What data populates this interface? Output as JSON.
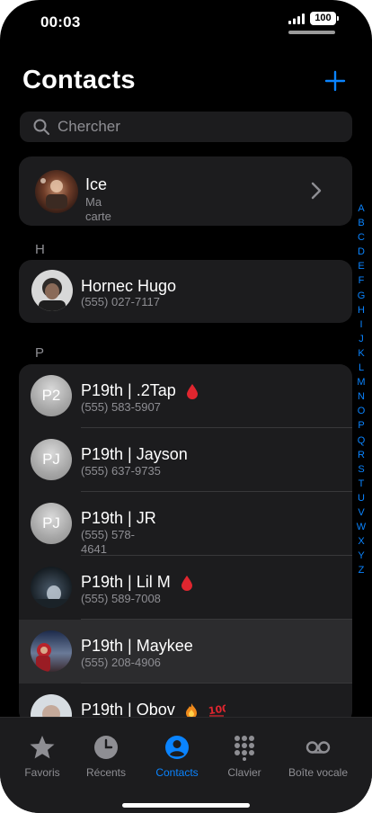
{
  "status_bar": {
    "time": "00:03",
    "battery": "100"
  },
  "header": {
    "title": "Contacts",
    "add_icon": "plus-icon"
  },
  "search": {
    "placeholder": "Chercher",
    "value": ""
  },
  "my_card": {
    "name": "Ice",
    "subtitle_line1": "Ma",
    "subtitle_line2": "carte"
  },
  "sections": [
    {
      "letter": "H",
      "contacts": [
        {
          "name": "Hornec Hugo",
          "phone": "(555) 027-7117"
        }
      ]
    },
    {
      "letter": "P",
      "contacts": [
        {
          "name": "P19th | .2Tap",
          "phone": "(555) 583-5907",
          "initials": "P2",
          "emoji": "blood-drop"
        },
        {
          "name": "P19th | Jayson",
          "phone": "(555) 637-9735",
          "initials": "PJ"
        },
        {
          "name": "P19th | JR",
          "phone_line1": "(555) 578-",
          "phone_line2": "4641",
          "initials": "PJ"
        },
        {
          "name": "P19th | Lil M",
          "phone": "(555) 589-7008",
          "emoji": "blood-drop"
        },
        {
          "name": "P19th | Maykee",
          "phone": "(555) 208-4906"
        },
        {
          "name": "P19th | Obov",
          "emoji": "fire-and-100"
        }
      ]
    }
  ],
  "index_letters": [
    "A",
    "B",
    "C",
    "D",
    "E",
    "F",
    "G",
    "H",
    "I",
    "J",
    "K",
    "L",
    "M",
    "N",
    "O",
    "P",
    "Q",
    "R",
    "S",
    "T",
    "U",
    "V",
    "W",
    "X",
    "Y",
    "Z"
  ],
  "tabs": [
    {
      "label": "Favoris",
      "icon": "star-icon"
    },
    {
      "label": "Récents",
      "icon": "clock-icon"
    },
    {
      "label": "Contacts",
      "icon": "person-circle-icon",
      "active": true
    },
    {
      "label": "Clavier",
      "icon": "keypad-icon"
    },
    {
      "label": "Boîte vocale",
      "icon": "voicemail-icon"
    }
  ],
  "colors": {
    "accent": "#0a84ff",
    "background": "#000000",
    "card": "#1c1c1e",
    "secondary_text": "#8e8e93"
  }
}
